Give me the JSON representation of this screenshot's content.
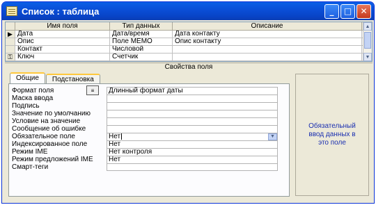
{
  "window": {
    "title": "Список : таблица",
    "minimize_glyph": "_",
    "maximize_glyph": "□",
    "close_glyph": "✕"
  },
  "grid": {
    "columns": [
      "Имя поля",
      "Тип данных",
      "Описание"
    ],
    "rows": [
      {
        "name": "Дата",
        "type": "Дата/время",
        "description": "Дата контакту",
        "selector": "▶"
      },
      {
        "name": "Опис",
        "type": "Поле MEMO",
        "description": "Опис контакту",
        "selector": ""
      },
      {
        "name": "Контакт",
        "type": "Числовой",
        "description": "",
        "selector": ""
      },
      {
        "name": "Ключ",
        "type": "Счетчик",
        "description": "",
        "selector": "⚿"
      }
    ]
  },
  "properties_label": "Свойства поля",
  "tabs": [
    {
      "label": "Общие",
      "active": true
    },
    {
      "label": "Подстановка",
      "active": false
    }
  ],
  "properties": [
    {
      "label": "Формат поля",
      "value": "Длинный формат даты"
    },
    {
      "label": "Маска ввода",
      "value": ""
    },
    {
      "label": "Подпись",
      "value": ""
    },
    {
      "label": "Значение по умолчанию",
      "value": ""
    },
    {
      "label": "Условие на значение",
      "value": ""
    },
    {
      "label": "Сообщение об ошибке",
      "value": ""
    },
    {
      "label": "Обязательное поле",
      "value": "Нет"
    },
    {
      "label": "Индексированное поле",
      "value": "Нет"
    },
    {
      "label": "Режим IME",
      "value": "Нет контроля"
    },
    {
      "label": "Режим предложений IME",
      "value": "Нет"
    },
    {
      "label": "Смарт-теги",
      "value": ""
    }
  ],
  "hint_text": "Обязательный ввод данных в это поле",
  "colors": {
    "hint_text": "#1a2fb0",
    "titlebar": "#0a4fd8",
    "tab_highlight": "#ffc83c"
  }
}
